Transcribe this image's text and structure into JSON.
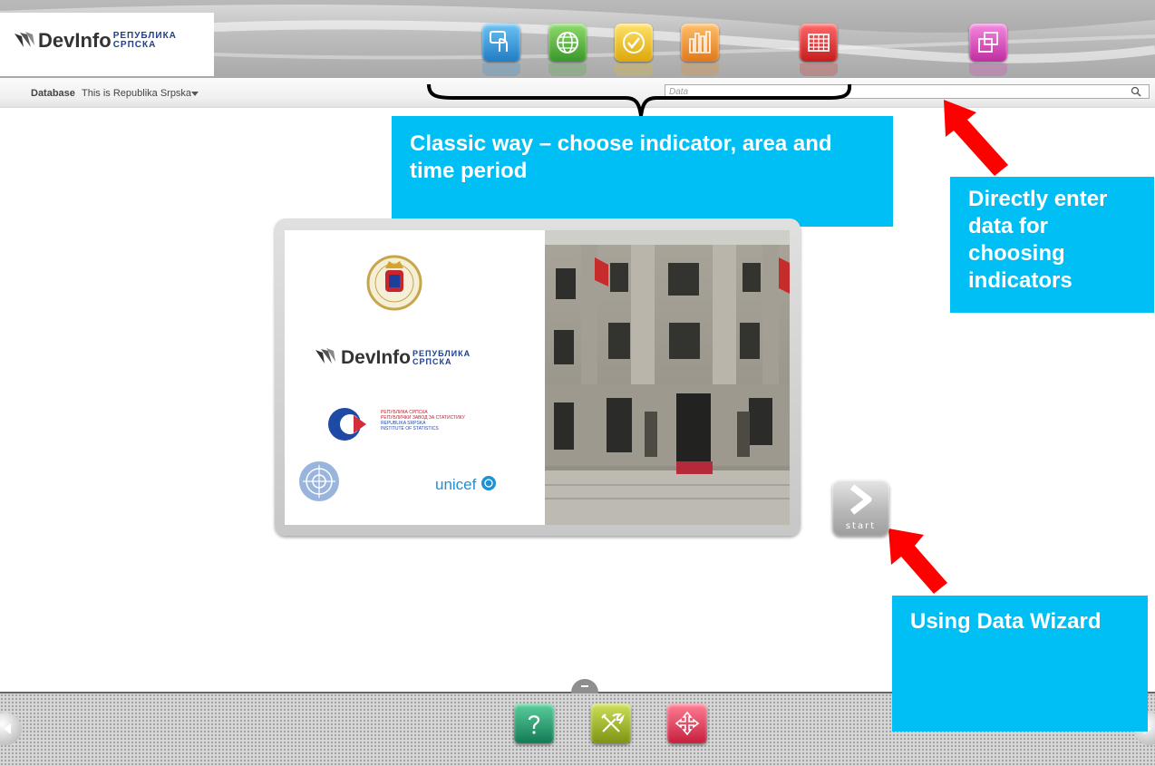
{
  "header": {
    "logo": {
      "wordmark": "DevInfo",
      "cyrillic_line1": "РЕПУБЛИКА",
      "cyrillic_line2": "СРПСКА"
    },
    "toolbar_icons": [
      {
        "name": "indicator-icon",
        "color": "#2b8fd6"
      },
      {
        "name": "globe-area-icon",
        "color": "#49a834"
      },
      {
        "name": "checkmark-time-icon",
        "color": "#e9bb12"
      },
      {
        "name": "bar-chart-icon",
        "color": "#e98a1c"
      },
      {
        "name": "table-grid-icon",
        "color": "#d92a2a"
      },
      {
        "name": "gallery-icon",
        "color": "#d53bb4"
      }
    ]
  },
  "subbar": {
    "database_label": "Database",
    "database_value": "This is Republika Srpska",
    "search_placeholder": "Data"
  },
  "annotations": {
    "classic": "Classic way – choose indicator, area and time period",
    "search": "Directly enter data for choosing indicators",
    "wizard": "Using Data Wizard",
    "accent_color": "#00bff5",
    "arrow_color": "#ff0000"
  },
  "panel": {
    "logo": {
      "wordmark": "DevInfo",
      "cyrillic_line1": "РЕПУБЛИКА",
      "cyrillic_line2": "СРПСКА"
    },
    "institute_lines": [
      "РЕПУБЛИКА СРПСКА",
      "РЕПУБЛИЧКИ ЗАВОД ЗА СТАТИСТИКУ",
      "REPUBLIKA SRPSKA",
      "INSTITUTE OF STATISTICS"
    ],
    "unicef": "unicef"
  },
  "start_button": {
    "label": "start"
  },
  "bottom_bar": {
    "icons": [
      {
        "name": "help-icon",
        "color": "#1e9a6f"
      },
      {
        "name": "tools-icon",
        "color": "#9bb817"
      },
      {
        "name": "expand-icon",
        "color": "#e0344e"
      }
    ]
  }
}
